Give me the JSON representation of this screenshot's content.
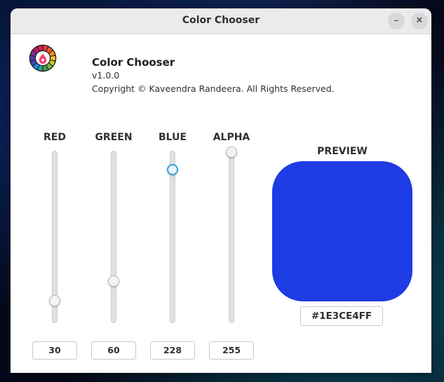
{
  "window": {
    "title": "Color Chooser"
  },
  "titlebar_buttons": {
    "minimize": "–",
    "close": "✕"
  },
  "app": {
    "name": "Color Chooser",
    "version": "v1.0.0",
    "copyright": "Copyright © Kaveendra Randeera. All Rights Reserved."
  },
  "sliders": [
    {
      "label": "RED",
      "value": "30",
      "max": 255
    },
    {
      "label": "GREEN",
      "value": "60",
      "max": 255
    },
    {
      "label": "BLUE",
      "value": "228",
      "max": 255,
      "focused": true
    },
    {
      "label": "ALPHA",
      "value": "255",
      "max": 255
    }
  ],
  "preview": {
    "label": "PREVIEW",
    "hex": "#1E3CE4FF",
    "color": "#1e3ce4"
  },
  "icons": {
    "logo": "color-wheel-drop-icon",
    "minimize": "minimize-icon",
    "close": "close-icon"
  }
}
